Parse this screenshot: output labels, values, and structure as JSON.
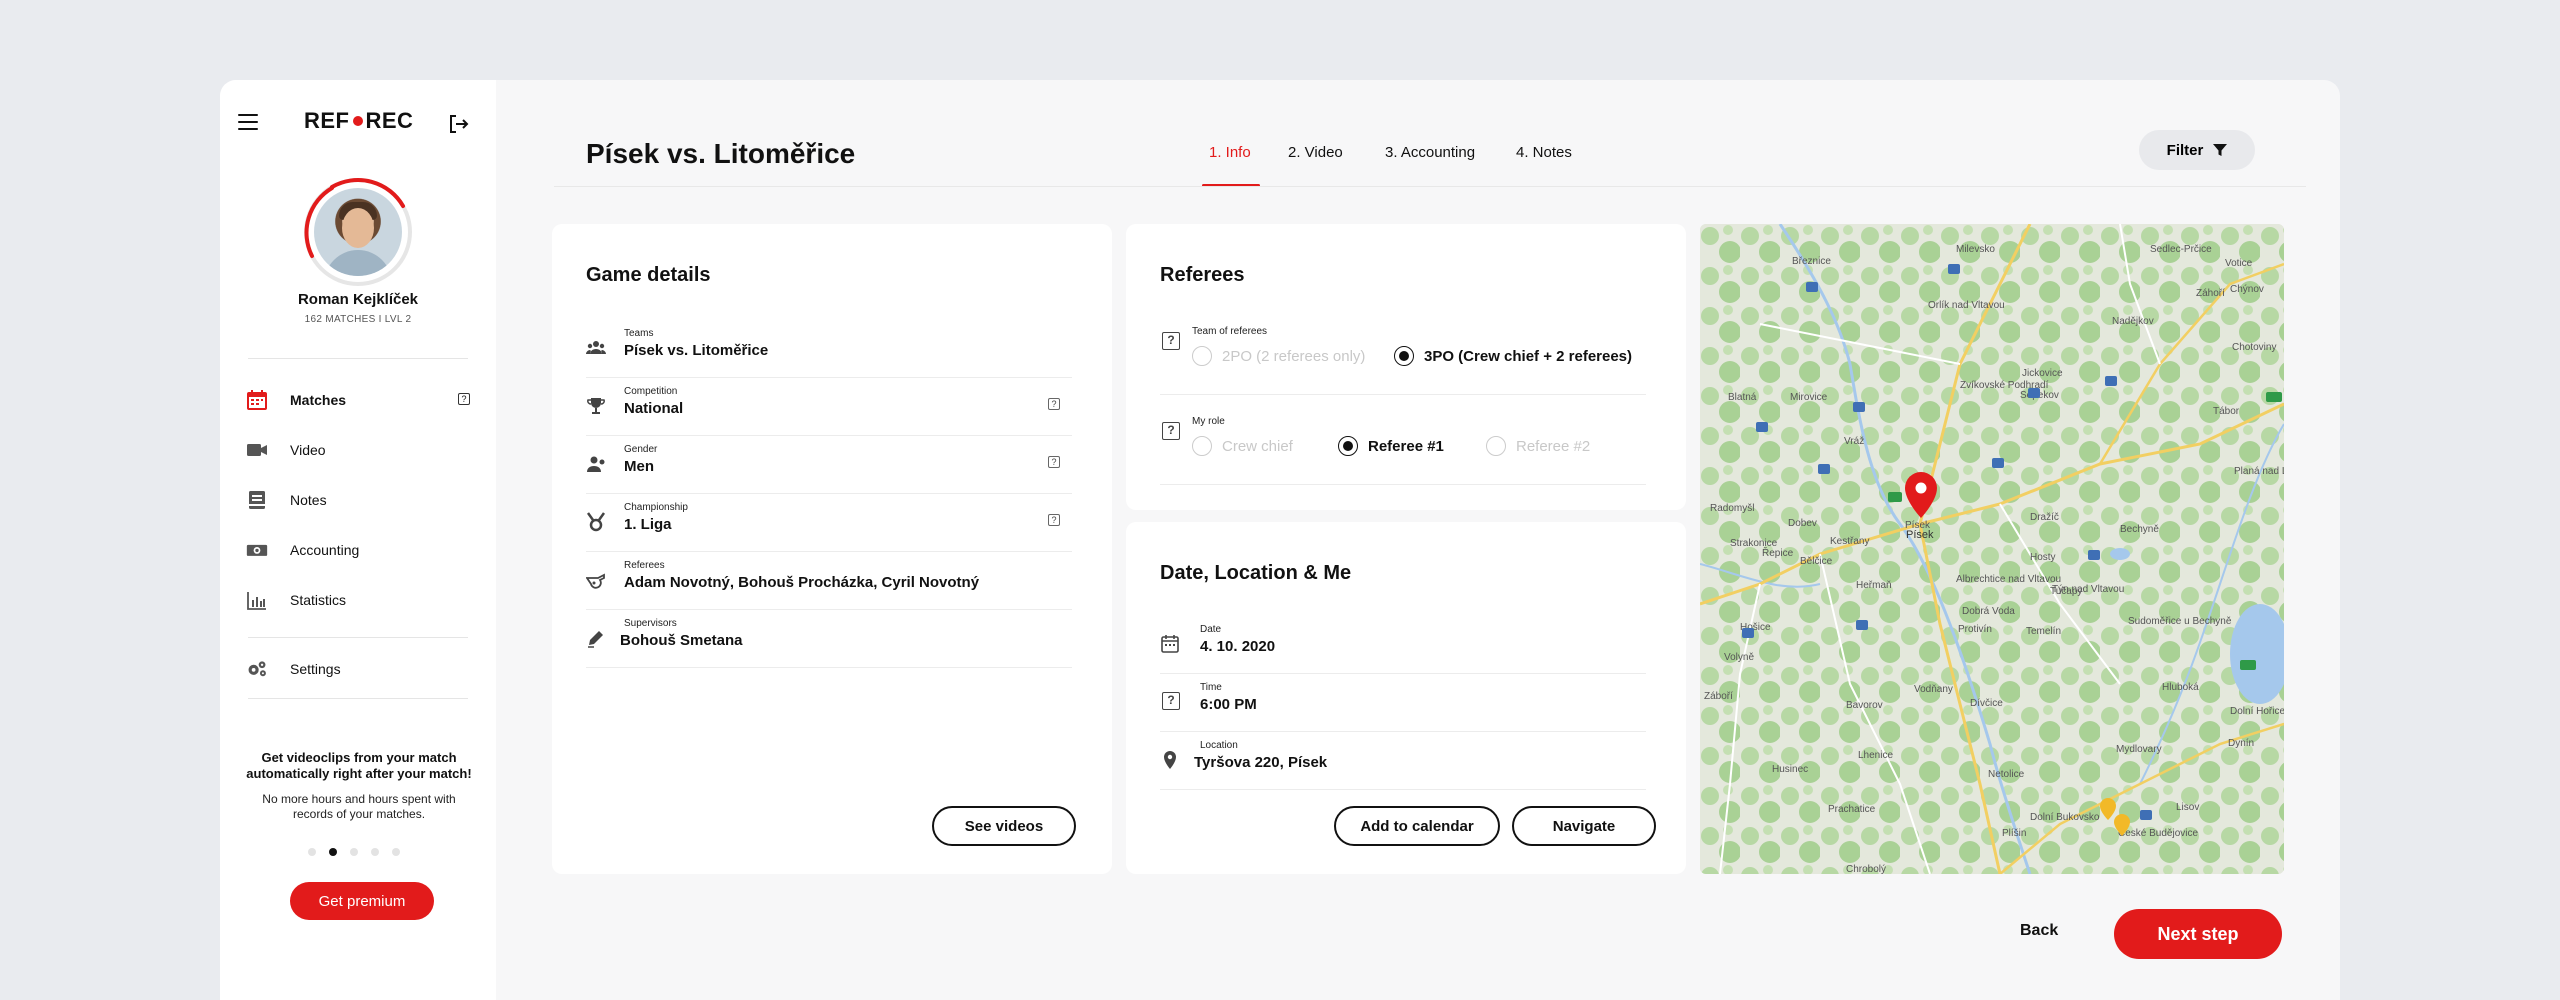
{
  "app": {
    "logo_left": "REF",
    "logo_right": "REC"
  },
  "user": {
    "name": "Roman Kejklíček",
    "meta": "162 MATCHES I LVL 2"
  },
  "sidebar": {
    "items": [
      {
        "label": "Matches",
        "icon": "calendar-icon",
        "active": true
      },
      {
        "label": "Video",
        "icon": "video-camera-icon"
      },
      {
        "label": "Notes",
        "icon": "notes-icon"
      },
      {
        "label": "Accounting",
        "icon": "money-icon"
      },
      {
        "label": "Statistics",
        "icon": "bar-chart-icon"
      },
      {
        "label": "Settings",
        "icon": "gears-icon"
      }
    ],
    "promo_title": "Get videoclips from your match automatically right after your match!",
    "promo_text": "No more hours and hours spent with records of your matches.",
    "premium_label": "Get premium"
  },
  "header": {
    "title": "Písek vs. Litoměřice",
    "tabs": [
      "1. Info",
      "2.  Video",
      "3. Accounting",
      "4. Notes"
    ],
    "active_tab": 0,
    "filter_label": "Filter"
  },
  "game_details": {
    "title": "Game details",
    "rows": [
      {
        "label": "Teams",
        "value": "Písek vs. Litoměřice",
        "icon": "people-icon"
      },
      {
        "label": "Competition",
        "value": "National",
        "icon": "trophy-icon"
      },
      {
        "label": "Gender",
        "value": "Men",
        "icon": "gender-icon"
      },
      {
        "label": "Championship",
        "value": "1. Liga",
        "icon": "medal-icon"
      },
      {
        "label": "Referees",
        "value": "Adam Novotný, Bohouš Procházka, Cyril Novotný",
        "icon": "whistle-icon"
      },
      {
        "label": "Supervisors",
        "value": "Bohouš Smetana",
        "icon": "pen-icon"
      }
    ],
    "see_videos_label": "See videos"
  },
  "referees": {
    "title": "Referees",
    "team_label": "Team of referees",
    "team_options": [
      "2PO (2 referees only)",
      "3PO (Crew chief + 2 referees)"
    ],
    "team_selected": 1,
    "role_label": "My role",
    "role_options": [
      "Crew chief",
      "Referee #1",
      "Referee #2"
    ],
    "role_selected": 1
  },
  "date_location": {
    "title": "Date, Location & Me",
    "date_label": "Date",
    "date_value": "4. 10. 2020",
    "time_label": "Time",
    "time_value": "6:00 PM",
    "location_label": "Location",
    "location_value": "Tyršova 220,  Písek",
    "add_calendar_label": "Add to calendar",
    "navigate_label": "Navigate"
  },
  "map": {
    "towns": [
      "Březnice",
      "Sedlec-Prčice",
      "Milevsko",
      "Orlík nad Vltavou",
      "Votice",
      "Chýnov",
      "Mirovice",
      "Záhoří",
      "Sepekov",
      "Tábor",
      "Blatná",
      "Jickovice",
      "Nadějkov",
      "Chotoviny",
      "Písek",
      "Radomyšl",
      "Dobev",
      "Vráž",
      "Dražíč",
      "Bechyně",
      "Strakonice",
      "Albrechtice nad Vltavou",
      "Hosty",
      "Týn nad Vltavou",
      "Heřmaň",
      "Protivín",
      "Temelín",
      "Hošice",
      "Volyně",
      "Vodňany",
      "Bavorov",
      "Dívčice",
      "Netolice",
      "Plíšin",
      "Husinec",
      "Prachatice",
      "Lisov",
      "České Budějovice",
      "Chrobolý",
      "Kestřany",
      "Zvíkovské Podhradí",
      "Tučapy",
      "Planá nad Lužnicí",
      "Dolní Hořice",
      "Řepice",
      "Bělčice",
      "Sudoměřice u Bechyně",
      "Dobrá Voda",
      "Dolní Bukovsko",
      "Mydlovary",
      "Dynín",
      "Hluboká",
      "Lhenice",
      "Záboří"
    ],
    "marker": "Písek"
  },
  "footer": {
    "back_label": "Back",
    "next_label": "Next step"
  },
  "colors": {
    "accent": "#e21b1b",
    "background": "#e9ebef",
    "panel": "#f7f7f8"
  }
}
